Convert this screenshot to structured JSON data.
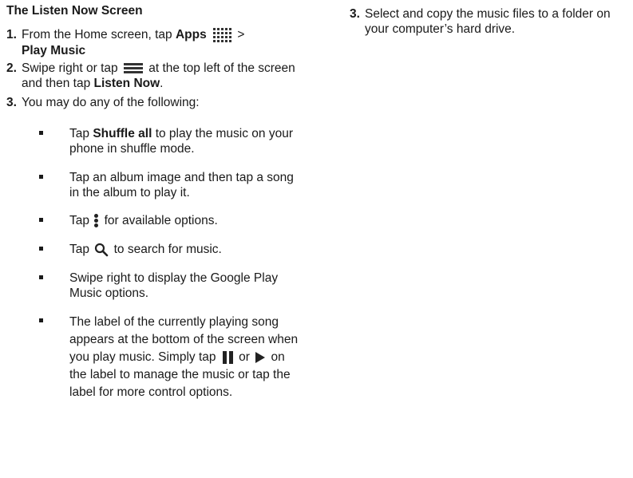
{
  "heading": "The Listen Now Screen",
  "left_steps": [
    {
      "num": "1.",
      "t1": "From the Home screen, tap ",
      "b1": "Apps",
      "t2": " > ",
      "b2": "Play Music"
    },
    {
      "num": "2.",
      "t1": "Swipe right or tap ",
      "t2": " at the top left of the screen and then tap ",
      "b1": "Listen Now",
      "t3": "."
    },
    {
      "num": "3.",
      "t1": "You may do any of the following:"
    }
  ],
  "bullets": [
    {
      "t1": "Tap ",
      "b1": "Shuffle all",
      "t2": " to play the music on your phone in shuffle mode."
    },
    {
      "t1": "Tap an album image and then tap a song in the album to play it."
    },
    {
      "t1": "Tap ",
      "t2": " for available options."
    },
    {
      "t1": "Tap ",
      "t2": " to search for music."
    },
    {
      "t1": "Swipe right to display the Google Play Music options."
    },
    {
      "t1": "The label of the currently playing song appears at the bottom of the screen when you play music. Simply tap ",
      "t2": " or ",
      "t3": " on the label to manage the music or tap the label for more control options."
    }
  ],
  "right_step": {
    "num": "3.",
    "t1": "Select and copy the music files to a folder on your computer’s hard drive."
  },
  "icons": {
    "apps": "apps-grid-icon",
    "menu": "menu-icon",
    "more": "more-vertical-icon",
    "search": "search-icon",
    "pause": "pause-icon",
    "play": "play-icon"
  }
}
